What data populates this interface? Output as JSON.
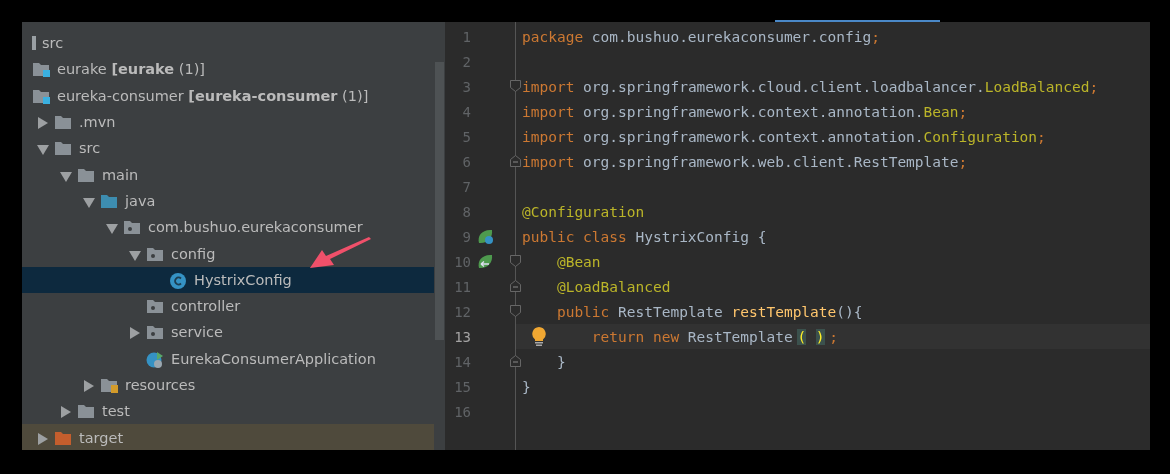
{
  "project_tree": {
    "items": [
      {
        "label": "src",
        "kind": "plain",
        "selected": false
      },
      {
        "label": "eurake **[eurake** (1)]",
        "kind": "module",
        "selected": false
      },
      {
        "label": "eureka-consumer **[eureka-consumer** (1)]",
        "kind": "module",
        "selected": false
      },
      {
        "label": ".mvn",
        "kind": "folder",
        "expanded": false,
        "selected": false
      },
      {
        "label": "src",
        "kind": "folder",
        "expanded": true,
        "selected": false,
        "children": [
          {
            "label": "main",
            "kind": "folder",
            "expanded": true,
            "selected": false,
            "children": [
              {
                "label": "java",
                "kind": "source-folder",
                "expanded": true,
                "selected": false,
                "children": [
                  {
                    "label": "com.bushuo.eurekaconsumer",
                    "kind": "package",
                    "expanded": true,
                    "selected": false,
                    "children": [
                      {
                        "label": "config",
                        "kind": "package",
                        "expanded": true,
                        "selected": false,
                        "children": [
                          {
                            "label": "HystrixConfig",
                            "kind": "class",
                            "selected": true
                          }
                        ]
                      },
                      {
                        "label": "controller",
                        "kind": "package",
                        "selected": false
                      },
                      {
                        "label": "service",
                        "kind": "package",
                        "expanded": false,
                        "selected": false
                      },
                      {
                        "label": "EurekaConsumerApplication",
                        "kind": "spring-class",
                        "selected": false
                      }
                    ]
                  }
                ]
              },
              {
                "label": "resources",
                "kind": "resources-folder",
                "expanded": false,
                "selected": false
              }
            ]
          },
          {
            "label": "test",
            "kind": "folder",
            "expanded": false,
            "selected": false
          }
        ]
      },
      {
        "label": "target",
        "kind": "excluded-folder",
        "expanded": false,
        "selected": false
      }
    ]
  },
  "editor": {
    "lines": [
      {
        "number": "1",
        "current": false,
        "tokens": [
          {
            "text": "package",
            "kind": "keyword"
          },
          {
            "text": " com.bushuo.eurekaconsumer.config",
            "kind": "plain"
          },
          {
            "text": ";",
            "kind": "keyword"
          }
        ]
      },
      {
        "number": "2",
        "current": false
      },
      {
        "number": "3",
        "current": false,
        "fold": {
          "kind": "start"
        },
        "tokens": [
          {
            "text": "import",
            "kind": "keyword"
          },
          {
            "text": " org.springframework.cloud.client.loadbalancer.",
            "kind": "plain"
          },
          {
            "text": "LoadBalanced",
            "kind": "annotation"
          },
          {
            "text": ";",
            "kind": "keyword"
          }
        ]
      },
      {
        "number": "4",
        "current": false,
        "tokens": [
          {
            "text": "import",
            "kind": "keyword"
          },
          {
            "text": " org.springframework.context.annotation.",
            "kind": "plain"
          },
          {
            "text": "Bean",
            "kind": "annotation"
          },
          {
            "text": ";",
            "kind": "keyword"
          }
        ]
      },
      {
        "number": "5",
        "current": false,
        "tokens": [
          {
            "text": "import",
            "kind": "keyword"
          },
          {
            "text": " org.springframework.context.annotation.",
            "kind": "plain"
          },
          {
            "text": "Configuration",
            "kind": "annotation"
          },
          {
            "text": ";",
            "kind": "keyword"
          }
        ]
      },
      {
        "number": "6",
        "current": false,
        "fold": {
          "kind": "end"
        },
        "tokens": [
          {
            "text": "import",
            "kind": "keyword"
          },
          {
            "text": " org.springframework.web.client.RestTemplate",
            "kind": "plain"
          },
          {
            "text": ";",
            "kind": "keyword"
          }
        ]
      },
      {
        "number": "7",
        "current": false
      },
      {
        "number": "8",
        "current": false,
        "tokens": [
          {
            "text": "@Configuration",
            "kind": "annotation"
          }
        ]
      },
      {
        "number": "9",
        "current": false,
        "gutter_icon": {
          "kind": "spring-bean"
        },
        "tokens": [
          {
            "text": "public class",
            "kind": "keyword"
          },
          {
            "text": " HystrixConfig {",
            "kind": "plain"
          }
        ]
      },
      {
        "number": "10",
        "current": false,
        "gutter_icon": {
          "kind": "bean-method"
        },
        "fold": {
          "kind": "start"
        },
        "tokens": [
          {
            "text": "    @Bean",
            "kind": "annotation"
          }
        ]
      },
      {
        "number": "11",
        "current": false,
        "fold": {
          "kind": "end"
        },
        "tokens": [
          {
            "text": "    @LoadBalanced",
            "kind": "annotation"
          }
        ]
      },
      {
        "number": "12",
        "current": false,
        "fold": {
          "kind": "start"
        },
        "tokens": [
          {
            "text": "    public",
            "kind": "keyword"
          },
          {
            "text": " RestTemplate ",
            "kind": "plain"
          },
          {
            "text": "restTemplate",
            "kind": "method"
          },
          {
            "text": "(){",
            "kind": "plain"
          }
        ]
      },
      {
        "number": "13",
        "current": true,
        "bulb": true,
        "tokens": [
          {
            "text": "        return new",
            "kind": "keyword"
          },
          {
            "text": " RestTemplate",
            "kind": "plain"
          },
          {
            "text": "(",
            "kind": "brace-match"
          },
          {
            "text": ")",
            "kind": "brace-match"
          },
          {
            "text": ";",
            "kind": "keyword"
          }
        ]
      },
      {
        "number": "14",
        "current": false,
        "fold": {
          "kind": "end"
        },
        "tokens": [
          {
            "text": "    }",
            "kind": "plain"
          }
        ]
      },
      {
        "number": "15",
        "current": false,
        "tokens": [
          {
            "text": "}",
            "kind": "plain"
          }
        ]
      },
      {
        "number": "16",
        "current": false
      }
    ]
  }
}
